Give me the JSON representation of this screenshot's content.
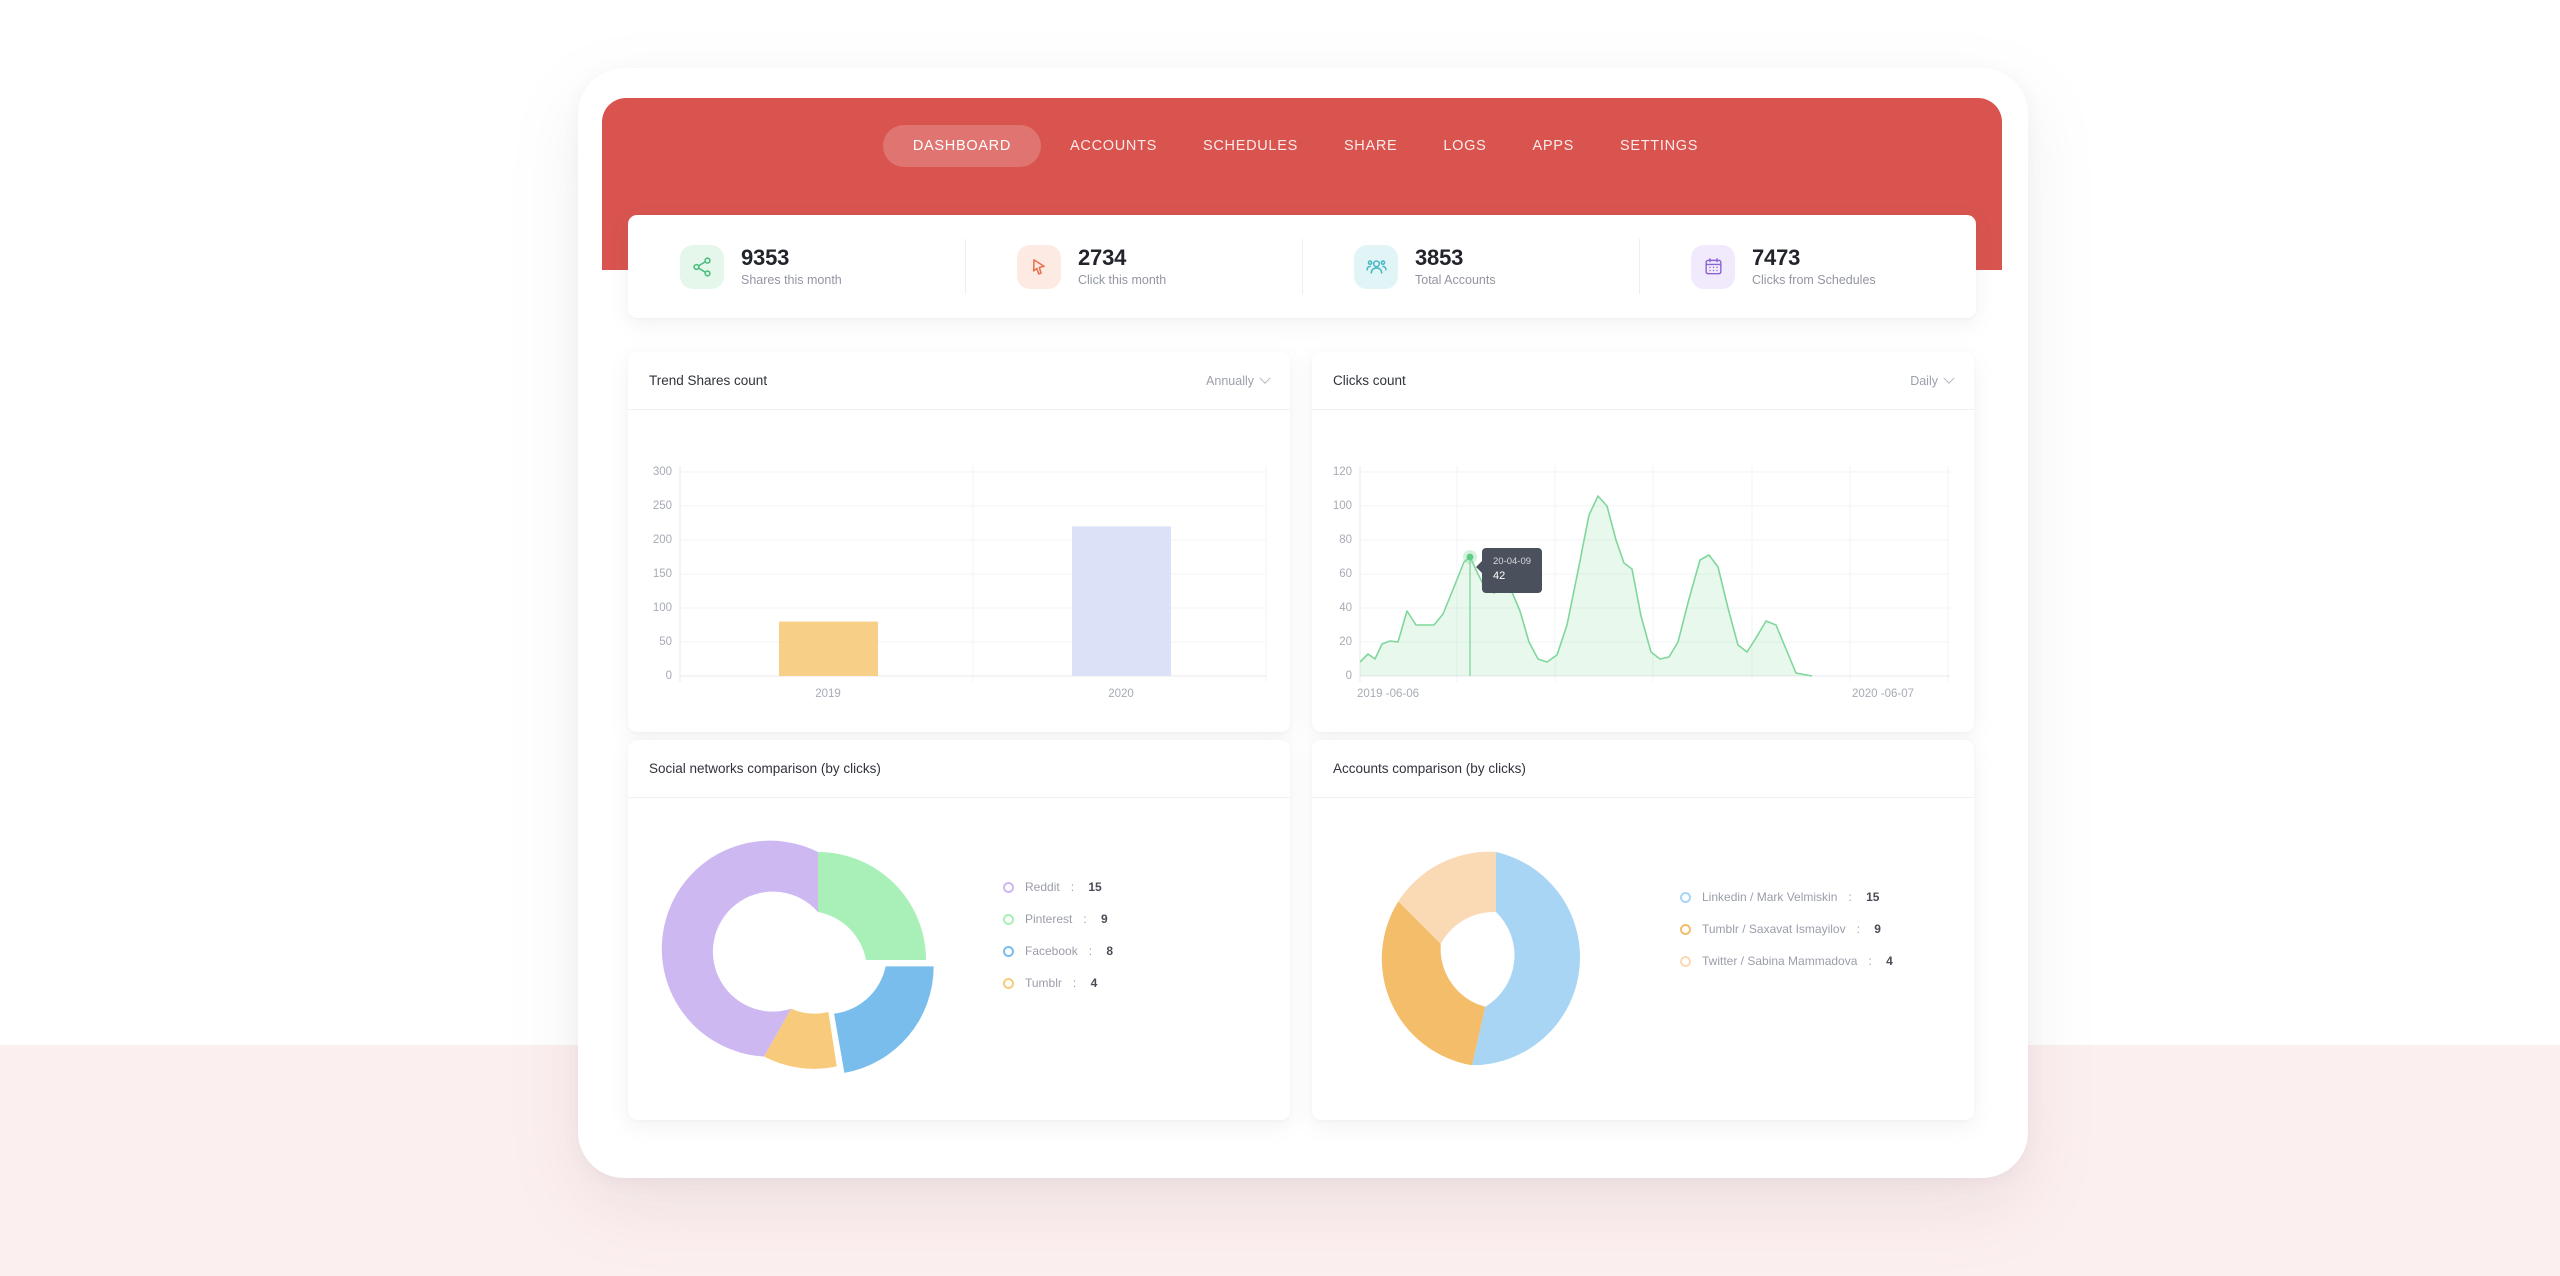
{
  "theme": {
    "brand_red": "#d9544f",
    "page_bg_top": "#ffffff",
    "page_bg_bottom": "#fcefef"
  },
  "nav": {
    "items": [
      {
        "label": "DASHBOARD",
        "active": true
      },
      {
        "label": "ACCOUNTS",
        "active": false
      },
      {
        "label": "SCHEDULES",
        "active": false
      },
      {
        "label": "SHARE",
        "active": false
      },
      {
        "label": "LOGS",
        "active": false
      },
      {
        "label": "APPS",
        "active": false
      },
      {
        "label": "SETTINGS",
        "active": false
      }
    ]
  },
  "stats": [
    {
      "value": "9353",
      "label": "Shares this month",
      "icon": "share-icon",
      "color": "#4dbd7e",
      "bg": "#e4f7ea"
    },
    {
      "value": "2734",
      "label": "Click this month",
      "icon": "cursor-icon",
      "color": "#e8714d",
      "bg": "#fdeae3"
    },
    {
      "value": "3853",
      "label": "Total Accounts",
      "icon": "users-icon",
      "color": "#49b6c4",
      "bg": "#e1f5f7"
    },
    {
      "value": "7473",
      "label": "Clicks from Schedules",
      "icon": "calendar-icon",
      "color": "#8a63d2",
      "bg": "#f0eafc"
    }
  ],
  "cards": {
    "trend": {
      "title": "Trend Shares count",
      "select": "Annually"
    },
    "clicks": {
      "title": "Clicks count",
      "select": "Daily"
    },
    "social": {
      "title": "Social networks comparison (by clicks)"
    },
    "accounts": {
      "title": "Accounts comparison (by clicks)"
    }
  },
  "chart_data": [
    {
      "id": "trend-shares",
      "type": "bar",
      "title": "Trend Shares count",
      "categories": [
        "2019",
        "2020"
      ],
      "values": [
        80,
        220
      ],
      "colors": [
        "#f7cf86",
        "#dbe2f7"
      ],
      "ylabel": "",
      "xlabel": "",
      "ylim": [
        0,
        300
      ],
      "yticks": [
        0,
        50,
        100,
        150,
        200,
        250,
        300
      ],
      "grid": true,
      "legend": "none"
    },
    {
      "id": "clicks-count",
      "type": "area",
      "title": "Clicks count",
      "xlabel": "",
      "ylabel": "",
      "ylim": [
        0,
        120
      ],
      "yticks": [
        0,
        20,
        40,
        60,
        80,
        100,
        120
      ],
      "x_start_label": "2019 -06-06",
      "x_end_label": "2020 -06-07",
      "grid": true,
      "line_color": "#7fd79b",
      "fill_color": "rgba(140,218,160,0.20)",
      "tooltip": {
        "date": "20-04-09",
        "value": "42"
      },
      "values": [
        8,
        13,
        10,
        21,
        22,
        20,
        38,
        32,
        30,
        30,
        36,
        52,
        68,
        70,
        60,
        51,
        49,
        52,
        51,
        38,
        20,
        10,
        8,
        12,
        30,
        62,
        95,
        106,
        100,
        80,
        66,
        63,
        35,
        14,
        10,
        11,
        20,
        45,
        68,
        71,
        64,
        40,
        18,
        14,
        22,
        32,
        30,
        16,
        2
      ]
    },
    {
      "id": "social-networks",
      "type": "pie",
      "title": "Social networks comparison (by clicks)",
      "labels": [
        "Reddit",
        "Pinterest",
        "Facebook",
        "Tumblr"
      ],
      "values": [
        15,
        9,
        8,
        4
      ],
      "colors": [
        "#cdb8f2",
        "#a8f0b7",
        "#79bdec",
        "#f7cb7b"
      ],
      "highlighted": "Facebook",
      "highlight_value_label": "8",
      "legend": "right"
    },
    {
      "id": "accounts-comparison",
      "type": "pie",
      "title": "Accounts comparison (by clicks)",
      "labels": [
        "Linkedin / Mark Velmiskin",
        "Tumblr / Saxavat Ismayilov",
        "Twitter / Sabina Mammadova"
      ],
      "values": [
        15,
        9,
        4
      ],
      "colors": [
        "#a9d5f5",
        "#f6c униqueb",
        "#fae0bd"
      ],
      "legend": "right"
    }
  ],
  "legends": {
    "social": [
      {
        "name": "Reddit",
        "value": "15",
        "color": "#cdb8f2"
      },
      {
        "name": "Pinterest",
        "value": "9",
        "color": "#a8f0b7"
      },
      {
        "name": "Facebook",
        "value": "8",
        "color": "#79bdec"
      },
      {
        "name": "Tumblr",
        "value": "4",
        "color": "#f7cb7b"
      }
    ],
    "accounts": [
      {
        "name": "Linkedin / Mark Velmiskin",
        "value": "15",
        "color": "#a9d5f5"
      },
      {
        "name": "Tumblr / Saxavat Ismayilov",
        "value": "9",
        "color": "#f3bd6a"
      },
      {
        "name": "Twitter / Sabina Mammadova",
        "value": "4",
        "color": "#fad9b5"
      }
    ]
  },
  "axes": {
    "trend_y": [
      "300",
      "250",
      "200",
      "150",
      "100",
      "50",
      "0"
    ],
    "trend_x": [
      "2019",
      "2020"
    ],
    "clicks_y": [
      "120",
      "100",
      "80",
      "60",
      "40",
      "20",
      "0"
    ],
    "clicks_x": [
      "2019 -06-06",
      "2020 -06-07"
    ]
  }
}
